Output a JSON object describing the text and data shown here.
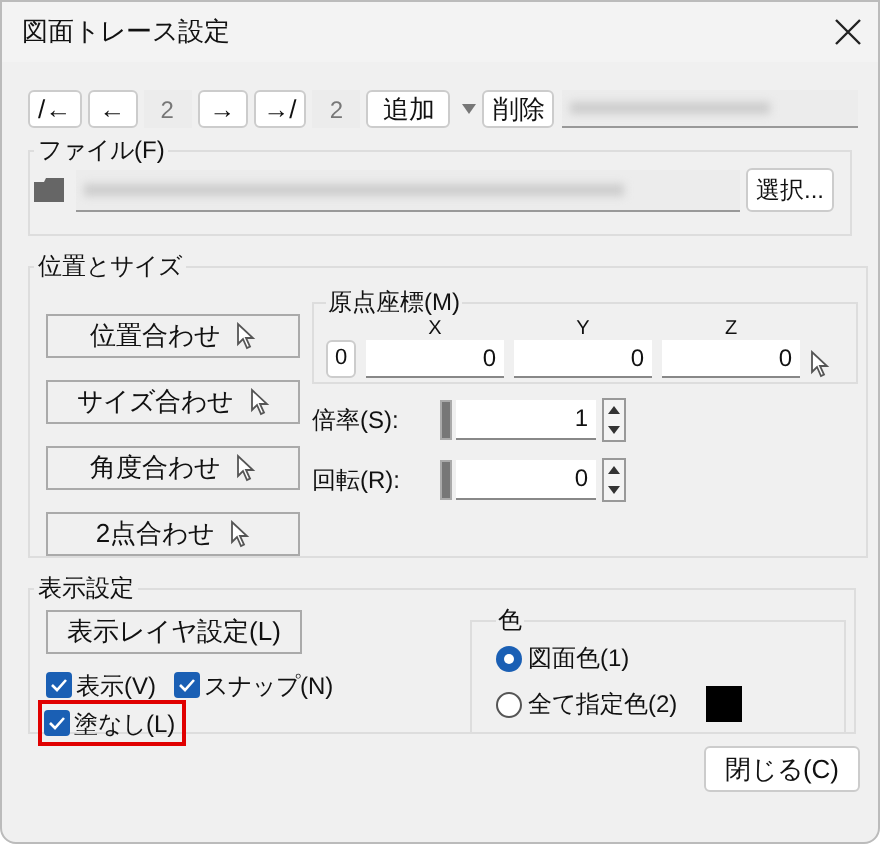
{
  "window": {
    "title": "図面トレース設定"
  },
  "toolbar": {
    "buttons": [
      {
        "kind": "nav",
        "label": "/←"
      },
      {
        "kind": "nav",
        "label": "←"
      },
      {
        "kind": "count",
        "label": "2"
      },
      {
        "kind": "nav",
        "label": "→"
      },
      {
        "kind": "nav",
        "label": "→/"
      },
      {
        "kind": "count",
        "label": "2"
      },
      {
        "kind": "split",
        "label": "追加"
      },
      {
        "kind": "nav",
        "label": "削除"
      }
    ]
  },
  "file": {
    "label": "ファイル(F)",
    "browse": "選択..."
  },
  "position_size": {
    "title": "位置とサイズ",
    "buttons": [
      "位置合わせ",
      "サイズ合わせ",
      "角度合わせ",
      "2点合わせ"
    ],
    "origin": {
      "label": "原点座標(M)",
      "reset": "0",
      "axes": [
        {
          "label": "X",
          "value": "0"
        },
        {
          "label": "Y",
          "value": "0"
        },
        {
          "label": "Z",
          "value": "0"
        }
      ]
    },
    "scale": {
      "label": "倍率(S):",
      "value": "1"
    },
    "rotation": {
      "label": "回転(R):",
      "value": "0"
    }
  },
  "display": {
    "title": "表示設定",
    "layer_button": "表示レイヤ設定(L)",
    "checkboxes": [
      {
        "label": "表示(V)",
        "checked": true,
        "highlighted": false
      },
      {
        "label": "スナップ(N)",
        "checked": true,
        "highlighted": false
      },
      {
        "label": "塗なし(L)",
        "checked": true,
        "highlighted": true
      }
    ]
  },
  "color": {
    "title": "色",
    "options": [
      {
        "label": "図面色(1)",
        "selected": true
      },
      {
        "label": "全て指定色(2)",
        "selected": false,
        "color": "#000000"
      }
    ]
  },
  "close": "閉じる(C)"
}
